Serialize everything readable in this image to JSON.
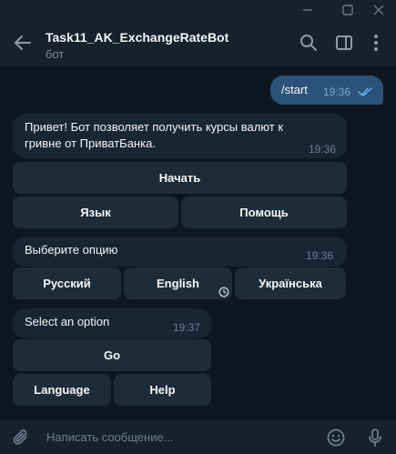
{
  "window": {
    "minimize_icon": "minimize-icon",
    "maximize_icon": "maximize-icon",
    "close_icon": "close-icon"
  },
  "header": {
    "title": "Task11_AK_ExchangeRateBot",
    "subtitle": "бот"
  },
  "messages": {
    "outgoing": {
      "text": "/start",
      "time": "19:36",
      "status": "read"
    },
    "greeting": {
      "text": "Привет! Бот позволяет получить курсы валют к гривне от ПриватБанка.",
      "time": "19:36",
      "buttons": {
        "start": "Начать",
        "language": "Язык",
        "help": "Помощь"
      }
    },
    "choose_ru": {
      "text": "Выберите опцию",
      "time": "19:36",
      "buttons": {
        "russian": "Русский",
        "english": "English",
        "ukrainian": "Українська"
      }
    },
    "choose_en": {
      "text": "Select an option",
      "time": "19:37",
      "buttons": {
        "go": "Go",
        "language": "Language",
        "help": "Help"
      }
    }
  },
  "composer": {
    "placeholder": "Написать сообщение..."
  },
  "colors": {
    "background": "#0e1621",
    "panel": "#17212b",
    "incoming_bubble": "#182533",
    "outgoing_bubble": "#2b5278",
    "keyboard_button": "#1e2c3a",
    "accent": "#5eb5f7"
  }
}
